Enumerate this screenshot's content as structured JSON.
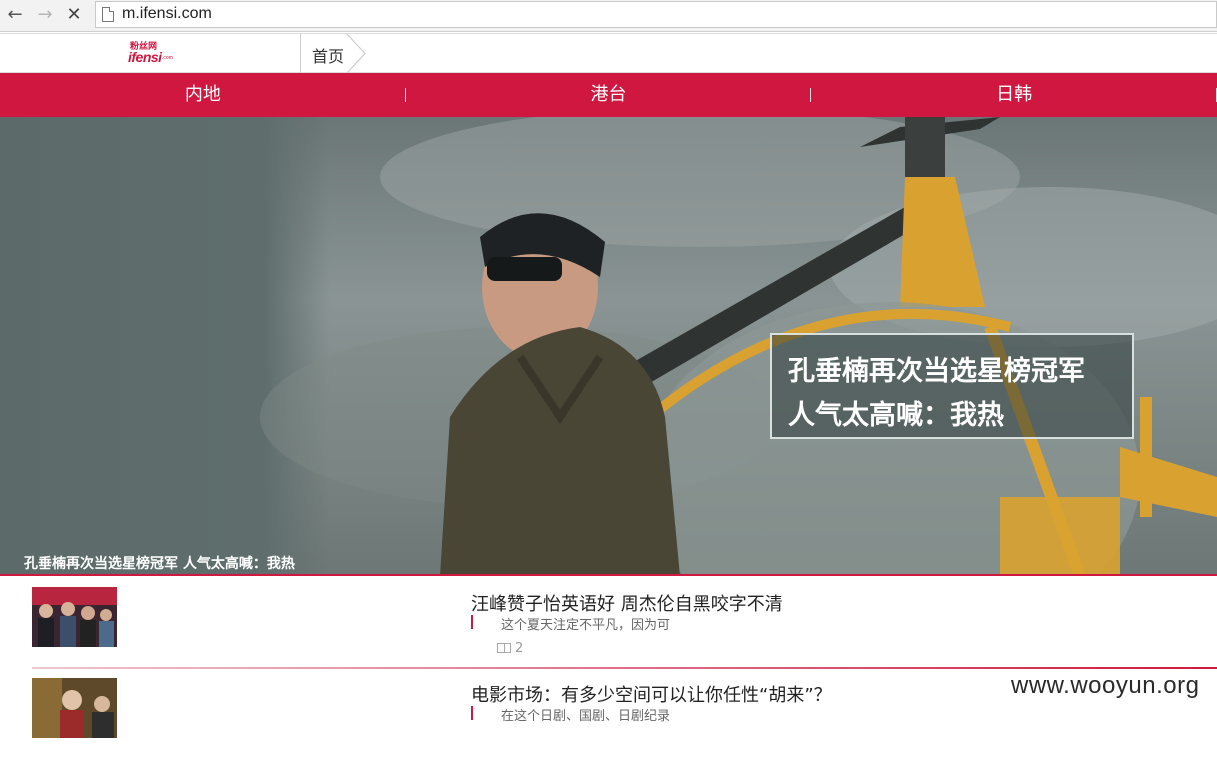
{
  "browser": {
    "url": "m.ifensi.com",
    "icons": [
      "back-arrow-icon",
      "forward-arrow-icon",
      "stop-icon",
      "page-icon"
    ]
  },
  "header": {
    "logo_cn": "粉丝网",
    "logo_en": "ifensi",
    "logo_domain": ".com",
    "breadcrumb": "首页"
  },
  "categories": [
    "内地",
    "港台",
    "日韩"
  ],
  "colors": {
    "brand": "#d0173f",
    "text": "#222222",
    "muted": "#666666"
  },
  "hero": {
    "overlay_line1": "孔垂楠再次当选星榜冠军",
    "overlay_line2": "人气太高喊：我热",
    "title": "孔垂楠再次当选星榜冠军 人气太高喊：我热"
  },
  "news": [
    {
      "title": "汪峰赞子怡英语好 周杰伦自黑咬字不清",
      "summary": "这个夏天注定不平凡，因为可",
      "comments": "2"
    },
    {
      "title": "电影市场：有多少空间可以让你任性“胡来”？",
      "summary": "在这个日剧、国剧、日剧纪录",
      "comments": ""
    }
  ],
  "watermark": "www.wooyun.org"
}
